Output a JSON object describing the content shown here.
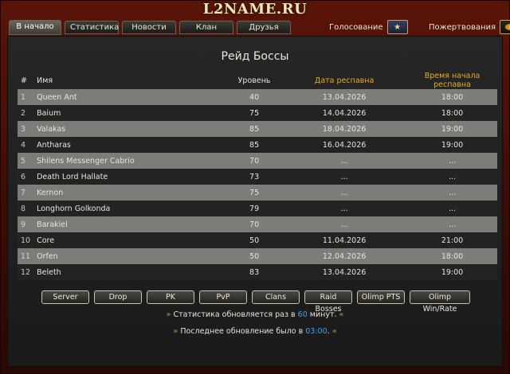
{
  "site": {
    "logo": "L2NAME.RU"
  },
  "nav": {
    "tabs": [
      {
        "label": "В начало"
      },
      {
        "label": "Статистика"
      },
      {
        "label": "Новости"
      },
      {
        "label": "Клан"
      },
      {
        "label": "Друзья"
      }
    ],
    "active_tab": 0
  },
  "header": {
    "vote_label": "Голосование",
    "donate_label": "Пожертвования"
  },
  "page": {
    "title": "Рейд Боссы"
  },
  "table": {
    "headers": {
      "num": "#",
      "name": "Имя",
      "level": "Уровень",
      "respawn_date": "Дата респавна",
      "respawn_start": "Время начала респавна"
    },
    "rows": [
      {
        "n": "1",
        "name": "Queen Ant",
        "level": "40",
        "date": "13.04.2026",
        "time": "18:00"
      },
      {
        "n": "2",
        "name": "Baium",
        "level": "75",
        "date": "14.04.2026",
        "time": "18:00"
      },
      {
        "n": "3",
        "name": "Valakas",
        "level": "85",
        "date": "18.04.2026",
        "time": "19:00"
      },
      {
        "n": "4",
        "name": "Antharas",
        "level": "85",
        "date": "16.04.2026",
        "time": "19:00"
      },
      {
        "n": "5",
        "name": "Shilens Messenger Cabrio",
        "level": "70",
        "date": "...",
        "time": "..."
      },
      {
        "n": "6",
        "name": "Death Lord Hallate",
        "level": "73",
        "date": "...",
        "time": "..."
      },
      {
        "n": "7",
        "name": "Kernon",
        "level": "75",
        "date": "...",
        "time": "..."
      },
      {
        "n": "8",
        "name": "Longhorn Golkonda",
        "level": "79",
        "date": "...",
        "time": "..."
      },
      {
        "n": "9",
        "name": "Barakiel",
        "level": "70",
        "date": "...",
        "time": "..."
      },
      {
        "n": "10",
        "name": "Core",
        "level": "50",
        "date": "11.04.2026",
        "time": "21:00"
      },
      {
        "n": "11",
        "name": "Orfen",
        "level": "50",
        "date": "12.04.2026",
        "time": "18:00"
      },
      {
        "n": "12",
        "name": "Beleth",
        "level": "83",
        "date": "13.04.2026",
        "time": "19:00"
      }
    ]
  },
  "buttons": [
    {
      "label": "Server"
    },
    {
      "label": "Drop"
    },
    {
      "label": "PK"
    },
    {
      "label": "PvP"
    },
    {
      "label": "Clans"
    },
    {
      "label": "Raid Bosses"
    },
    {
      "label": "Olimp PTS"
    },
    {
      "label": "Olimp Win/Rate"
    }
  ],
  "footer": {
    "marker_open": "»",
    "marker_close": "«",
    "update_prefix": "Статистика обновляется раз в",
    "update_value": "60",
    "update_suffix": "минут.",
    "last_prefix": "Последнее обновление было в",
    "last_value": "03:00",
    "last_suffix": "."
  },
  "colors": {
    "accent_gold": "#e8a927",
    "info_blue": "#3fa0e8",
    "marker_green": "#7ab648"
  }
}
